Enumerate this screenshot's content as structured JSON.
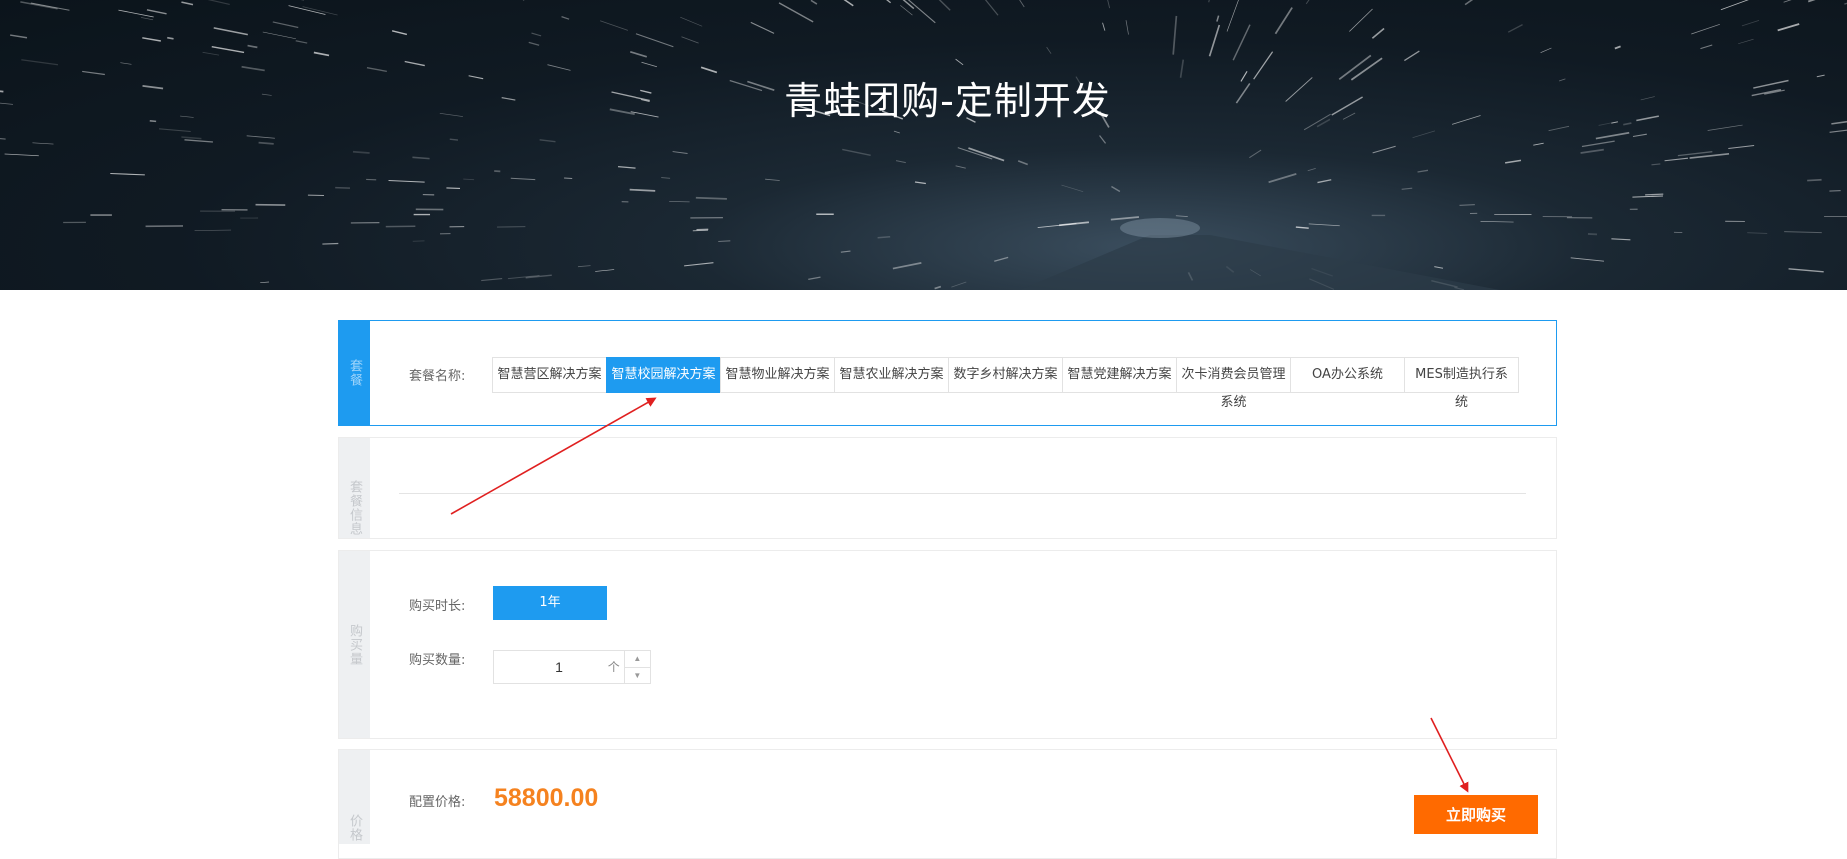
{
  "banner": {
    "title": "青蛙团购-定制开发"
  },
  "package": {
    "side_label": "套餐",
    "field_label": "套餐名称:",
    "options": [
      {
        "line1": "智慧营区解决方案",
        "line2": ""
      },
      {
        "line1": "智慧校园解决方案",
        "line2": ""
      },
      {
        "line1": "智慧物业解决方案",
        "line2": ""
      },
      {
        "line1": "智慧农业解决方案",
        "line2": ""
      },
      {
        "line1": "数字乡村解决方案",
        "line2": ""
      },
      {
        "line1": "智慧党建解决方案",
        "line2": ""
      },
      {
        "line1": "次卡消费会员管理",
        "line2": "系统"
      },
      {
        "line1": "OA办公系统",
        "line2": ""
      },
      {
        "line1": "MES制造执行系",
        "line2": "统"
      }
    ],
    "selected_index": 1
  },
  "package_info": {
    "side_label": "套餐信息"
  },
  "purchase": {
    "side_label": "购买量",
    "duration_label": "购买时长:",
    "duration_value": "1年",
    "quantity_label": "购买数量:",
    "quantity_value": "1",
    "quantity_unit": "个",
    "up_icon": "▲",
    "down_icon": "▼"
  },
  "price": {
    "side_label": "价格",
    "field_label": "配置价格:",
    "value": "58800.00",
    "buy_button": "立即购买"
  },
  "colors": {
    "accent_blue": "#1e9bf0",
    "price_orange": "#f5821f",
    "buy_orange": "#ff6a00",
    "annotation_red": "#e02020"
  }
}
